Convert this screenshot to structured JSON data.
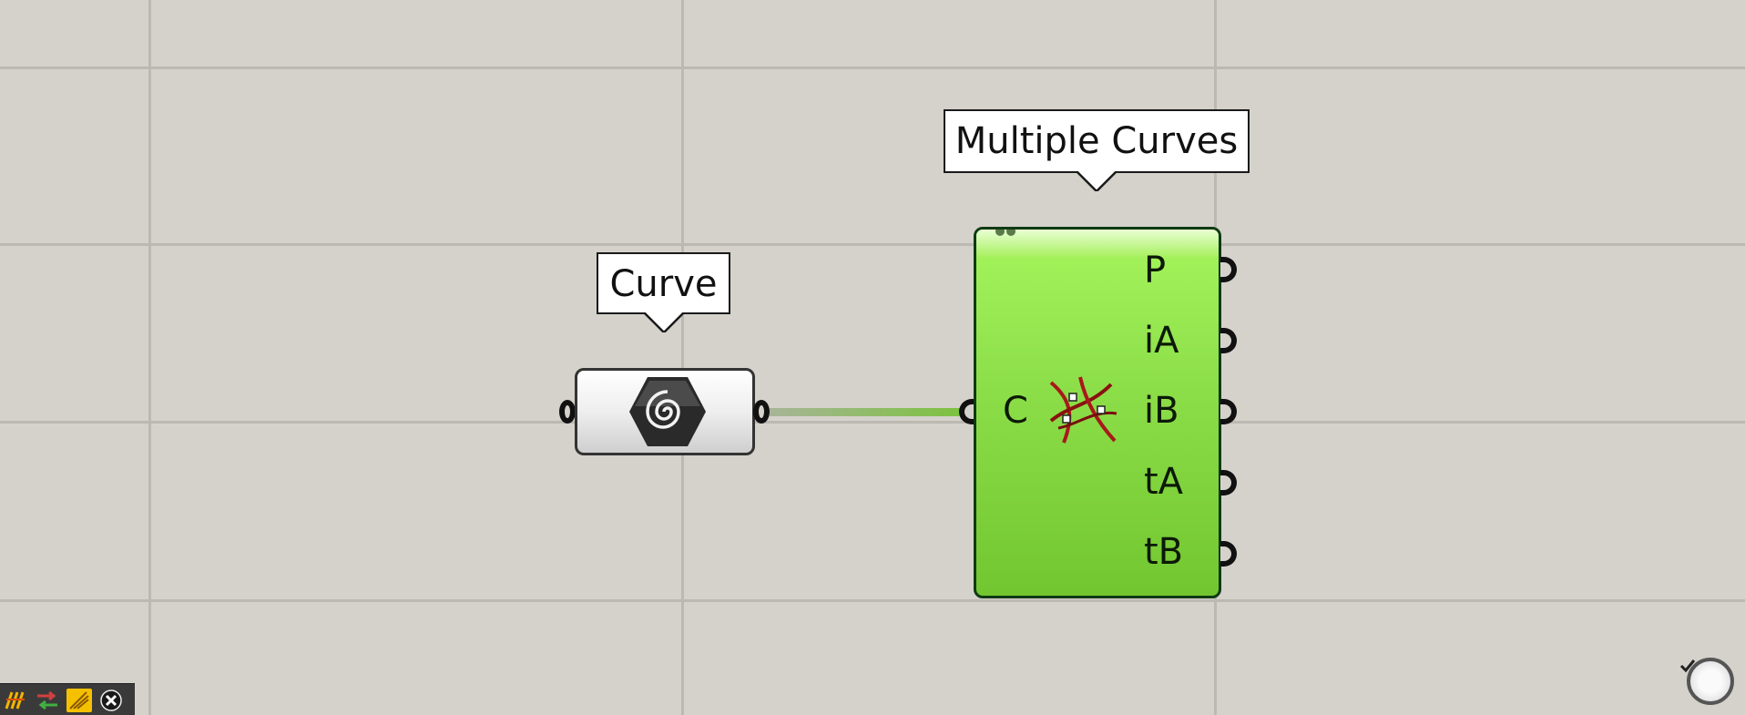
{
  "canvas": {
    "background": "#d5d1cb",
    "grid_color": "#bcb8b2"
  },
  "curve_param": {
    "label": "Curve",
    "icon": "curve-hexagon-icon"
  },
  "component": {
    "label": "Multiple Curves",
    "icon": "multiple-curves-intersection-icon",
    "color": "#8ee04a",
    "inputs": [
      {
        "name": "C"
      }
    ],
    "outputs": [
      {
        "name": "P"
      },
      {
        "name": "iA"
      },
      {
        "name": "iB"
      },
      {
        "name": "tA"
      },
      {
        "name": "tB"
      }
    ]
  },
  "toolbar": {
    "icons": [
      "grasshopper-icon",
      "shuffle-icon",
      "sketch-icon",
      "close-icon"
    ]
  },
  "nav_widget": {
    "icon": "navigation-wheel-icon"
  }
}
